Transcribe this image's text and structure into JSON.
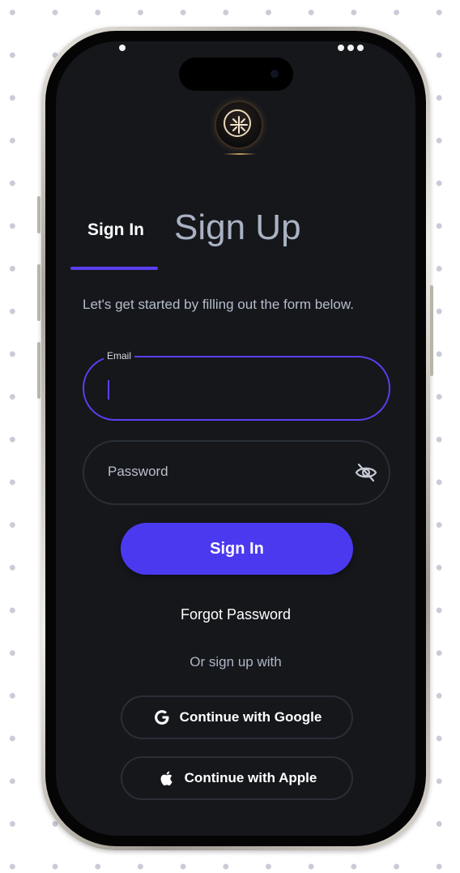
{
  "auth": {
    "tab_signin": "Sign In",
    "tab_signup": "Sign Up",
    "subtitle": "Let's get started by filling out the form below.",
    "email_label": "Email",
    "password_placeholder": "Password",
    "signin_button": "Sign In",
    "forgot_password": "Forgot Password",
    "or_text": "Or sign up with",
    "google_button": "Continue with Google",
    "apple_button": "Continue with Apple"
  },
  "icons": {
    "password_toggle": "eye-slash-icon",
    "google": "google-g-icon",
    "apple": "apple-logo-icon"
  },
  "colors": {
    "background": "#15171b",
    "accent": "#5a40f0",
    "button": "#4b39ef",
    "border": "#2a2e37",
    "text_primary": "#ffffff",
    "text_secondary": "#aeb6c5"
  }
}
